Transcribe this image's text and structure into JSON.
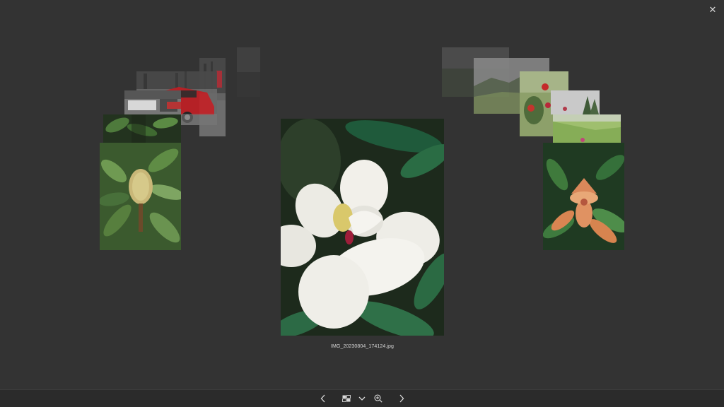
{
  "viewer": {
    "filename": "IMG_20230804_174124.jpg",
    "close_glyph": "✕"
  },
  "toolbar": {
    "items": [
      {
        "name": "previous-button",
        "icon": "chevron-left-icon"
      },
      {
        "name": "view-mode-button",
        "icon": "grid-view-icon"
      },
      {
        "name": "view-mode-dropdown",
        "icon": "chevron-down-icon"
      },
      {
        "name": "zoom-button",
        "icon": "zoom-in-icon"
      },
      {
        "name": "next-button",
        "icon": "chevron-right-icon"
      }
    ]
  },
  "colors": {
    "background": "#333333",
    "toolbar": "#2b2b2b",
    "text": "#d6d6d6"
  }
}
